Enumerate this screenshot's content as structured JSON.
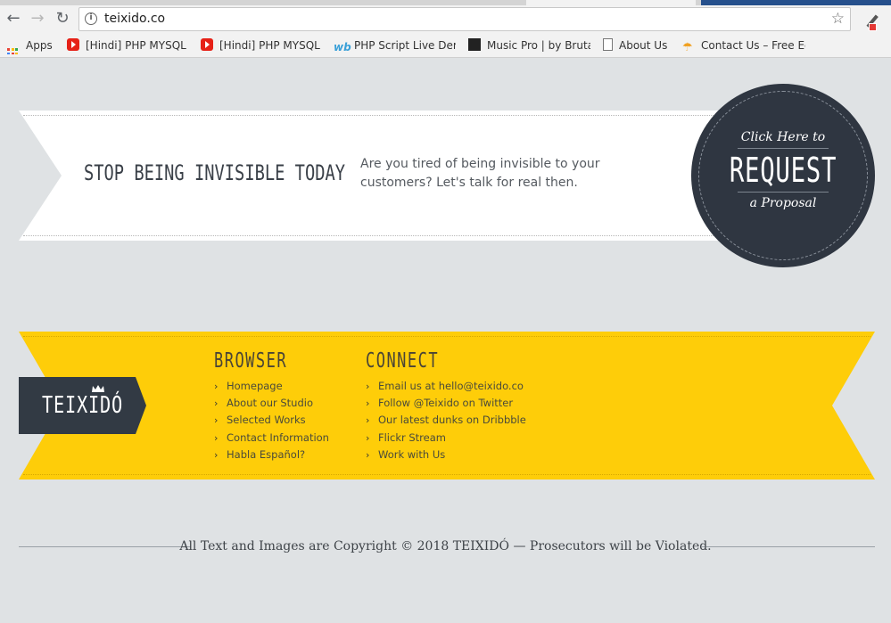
{
  "browser": {
    "url": "teixido.co",
    "bookmarks": [
      {
        "label": "Apps",
        "icon": "apps-grid-icon"
      },
      {
        "label": "[Hindi] PHP MYSQL",
        "icon": "youtube-icon"
      },
      {
        "label": "[Hindi] PHP MYSQL",
        "icon": "youtube-icon"
      },
      {
        "label": "PHP Script Live Dem",
        "icon": "wb-icon"
      },
      {
        "label": "Music Pro | by Brutal",
        "icon": "music-icon"
      },
      {
        "label": "About Us",
        "icon": "document-icon"
      },
      {
        "label": "Contact Us – Free Ed",
        "icon": "umbrella-icon"
      }
    ]
  },
  "promo": {
    "headline": "STOP BEING INVISIBLE TODAY",
    "text": "Are you tired of being invisible to your customers? Let's talk for real then.",
    "cta_top": "Click Here to",
    "cta_main": "REQUEST",
    "cta_bottom": "a Proposal"
  },
  "footer": {
    "logo": "TEIXIDÓ",
    "browser_heading": "BROWSER",
    "browser_links": [
      "Homepage",
      "About our Studio",
      "Selected Works",
      "Contact Information",
      "Habla Español?"
    ],
    "connect_heading": "CONNECT",
    "connect_links": [
      "Email us at hello@teixido.co",
      "Follow @Teixido on Twitter",
      "Our latest dunks on Dribbble",
      "Flickr Stream",
      "Work with Us"
    ],
    "copyright": "All Text and Images are Copyright © 2018 TEIXIDÓ — Prosecutors will be Violated."
  },
  "colors": {
    "banner_yellow": "#fecd09",
    "dark_slate": "#2f3641",
    "page_bg": "#dfe2e4"
  }
}
